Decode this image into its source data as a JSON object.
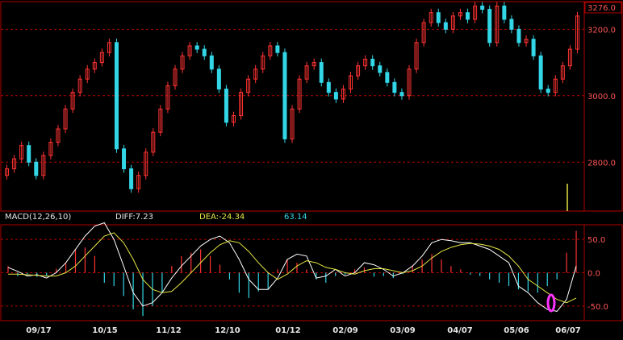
{
  "colors": {
    "background": "#000000",
    "frame": "#b00000",
    "grid": "#b00000",
    "up": "#ff3333",
    "down": "#33d6e6",
    "axis_text": "#e6e6e6",
    "price_label": "#ff5555",
    "macd_label": "#e6e6e6",
    "diff_label": "#e6e6e6",
    "dea_label": "#e6e645",
    "macd_value": "#33d6e6",
    "diff_line": "#ffffff",
    "dea_line": "#e6e645",
    "highlight": "#ff33ff"
  },
  "macd_header": {
    "name": "MACD(12,26,10)",
    "diff": "DIFF:7.23",
    "dea": "DEA:-24.34",
    "macd": "63.14"
  },
  "chart_data": [
    {
      "type": "candlestick",
      "title": "",
      "x_ticks": [
        "09/17",
        "10/15",
        "11/12",
        "12/10",
        "01/12",
        "02/09",
        "03/09",
        "04/07",
        "05/06",
        "06/07"
      ],
      "y_ticks": [
        2800.0,
        3000.0,
        3200.0
      ],
      "y_tick_labels": [
        "2800.0",
        "3000.0",
        "3200.0"
      ],
      "max_label": "3276.0",
      "ylim": [
        2660,
        3276
      ],
      "grid": true,
      "series_close": [
        2780,
        2810,
        2850,
        2800,
        2760,
        2820,
        2860,
        2900,
        2960,
        3010,
        3050,
        3080,
        3100,
        3130,
        3160,
        2840,
        2780,
        2720,
        2760,
        2830,
        2890,
        2960,
        3030,
        3080,
        3120,
        3150,
        3140,
        3120,
        3080,
        3020,
        2920,
        2940,
        3010,
        3050,
        3080,
        3120,
        3150,
        3130,
        2870,
        2960,
        3050,
        3090,
        3100,
        3040,
        3010,
        2990,
        3020,
        3060,
        3090,
        3110,
        3090,
        3070,
        3040,
        3010,
        3000,
        3080,
        3160,
        3220,
        3250,
        3220,
        3200,
        3240,
        3250,
        3230,
        3270,
        3260,
        3160,
        3270,
        3230,
        3200,
        3160,
        3170,
        3120,
        3020,
        3010,
        3050,
        3090,
        3140,
        3240
      ],
      "volume_note": "volume bar at last period"
    },
    {
      "type": "bar",
      "title": "MACD(12,26,10)",
      "y_ticks": [
        -50.0,
        0.0,
        50.0
      ],
      "y_tick_labels": [
        "-50.0",
        "0.0",
        "50.0"
      ],
      "ylim": [
        -72,
        72
      ],
      "legend": [
        "DIFF:7.23",
        "DEA:-24.34",
        "63.14"
      ],
      "diff": [
        8,
        2,
        -5,
        -3,
        -8,
        0,
        15,
        35,
        55,
        70,
        75,
        50,
        10,
        -30,
        -50,
        -45,
        -30,
        -8,
        10,
        25,
        40,
        50,
        55,
        45,
        20,
        -10,
        -25,
        -25,
        -8,
        20,
        28,
        25,
        -8,
        -5,
        5,
        -5,
        0,
        15,
        12,
        5,
        -5,
        0,
        10,
        25,
        45,
        50,
        48,
        45,
        45,
        40,
        35,
        25,
        15,
        -20,
        -30,
        -45,
        -55,
        -58,
        -40,
        10
      ],
      "dea": [
        -2,
        -2,
        -3,
        -4,
        -5,
        -5,
        0,
        10,
        25,
        40,
        55,
        60,
        45,
        20,
        -10,
        -25,
        -30,
        -28,
        -15,
        0,
        15,
        30,
        42,
        48,
        45,
        32,
        15,
        0,
        -10,
        -2,
        10,
        18,
        15,
        8,
        5,
        0,
        -2,
        3,
        6,
        6,
        3,
        0,
        3,
        10,
        22,
        32,
        38,
        42,
        44,
        43,
        40,
        35,
        25,
        10,
        -10,
        -20,
        -30,
        -40,
        -45,
        -38
      ],
      "hist": [
        10,
        -5,
        -2,
        -6,
        -5,
        6,
        15,
        35,
        38,
        25,
        -15,
        -20,
        -35,
        -55,
        -65,
        -50,
        -30,
        10,
        25,
        30,
        35,
        25,
        12,
        -10,
        -30,
        -38,
        -28,
        -25,
        5,
        20,
        15,
        5,
        -10,
        -15,
        -5,
        -3,
        5,
        8,
        -6,
        -5,
        -8,
        -2,
        10,
        20,
        28,
        20,
        10,
        5,
        -3,
        -5,
        -10,
        -15,
        -20,
        -25,
        -28,
        -30,
        -20,
        -10,
        30,
        63
      ]
    }
  ]
}
